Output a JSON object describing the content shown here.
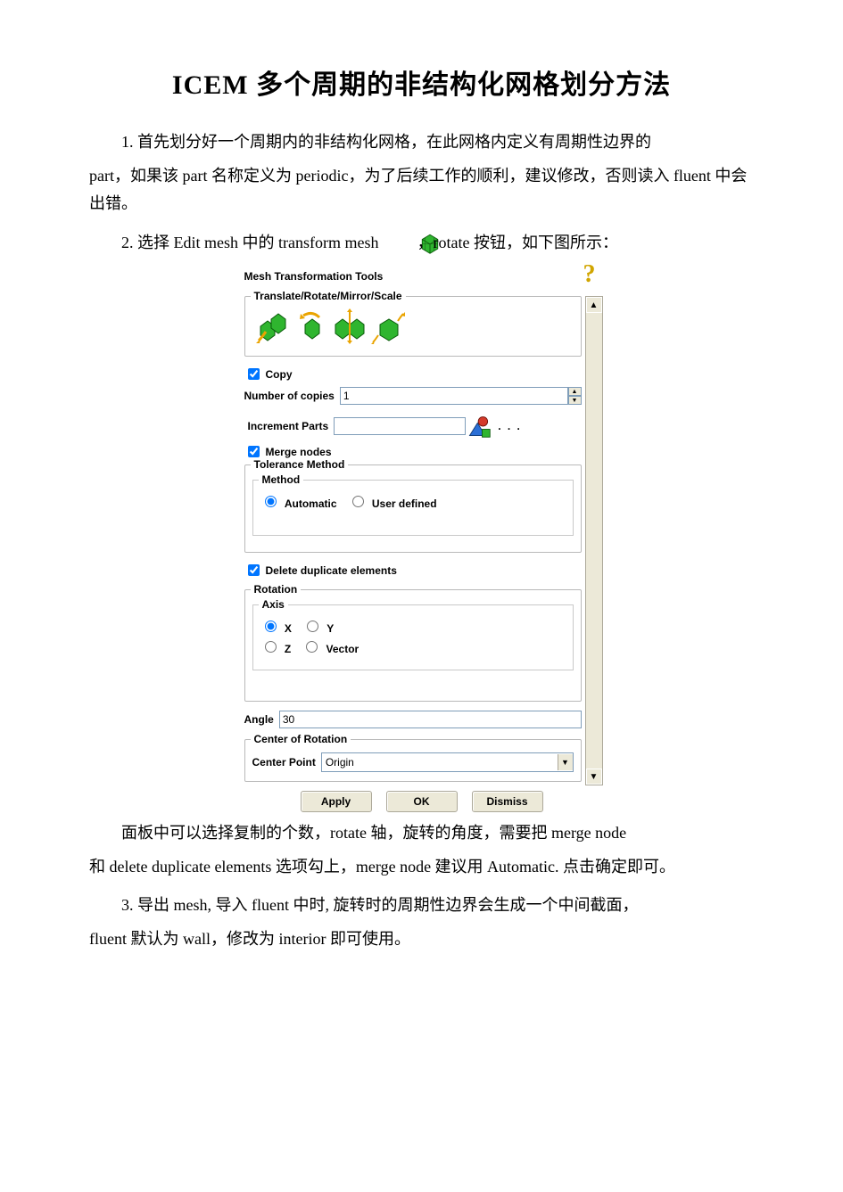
{
  "title": "ICEM 多个周期的非结构化网格划分方法",
  "para1_a": "1. 首先划分好一个周期内的非结构化网格，在此网格内定义有周期性边界的",
  "para1_b": "part，如果该 part 名称定义为 periodic，为了后续工作的顺利，建议修改，否则读入 fluent 中会出错。",
  "para2_a": "2. 选择 Edit mesh 中的 transform mesh",
  "para2_b": "，rotate 按钮，如下图所示：",
  "panel": {
    "header": "Mesh Transformation Tools",
    "trrs_title": "Translate/Rotate/Mirror/Scale",
    "copy_label": "Copy",
    "num_copies_label": "Number of copies",
    "num_copies_value": "1",
    "increment_parts_label": "Increment Parts",
    "increment_parts_value": "",
    "merge_nodes_label": "Merge nodes",
    "tolerance_title": "Tolerance Method",
    "method_title": "Method",
    "method_auto": "Automatic",
    "method_user": "User defined",
    "delete_dup_label": "Delete duplicate elements",
    "rotation_title": "Rotation",
    "axis_title": "Axis",
    "axis_x": "X",
    "axis_y": "Y",
    "axis_z": "Z",
    "axis_vec": "Vector",
    "angle_label": "Angle",
    "angle_value": "30",
    "center_rot_title": "Center of Rotation",
    "center_point_label": "Center Point",
    "center_point_value": "Origin",
    "apply": "Apply",
    "ok": "OK",
    "dismiss": "Dismiss"
  },
  "para3_a": "面板中可以选择复制的个数，rotate 轴，旋转的角度，需要把 merge node",
  "para3_b": "和 delete duplicate elements 选项勾上，merge node 建议用 Automatic. 点击确定即可。",
  "para4_a": "3. 导出 mesh, 导入 fluent 中时, 旋转时的周期性边界会生成一个中间截面，",
  "para4_b": "fluent 默认为 wall，修改为 interior 即可使用。"
}
